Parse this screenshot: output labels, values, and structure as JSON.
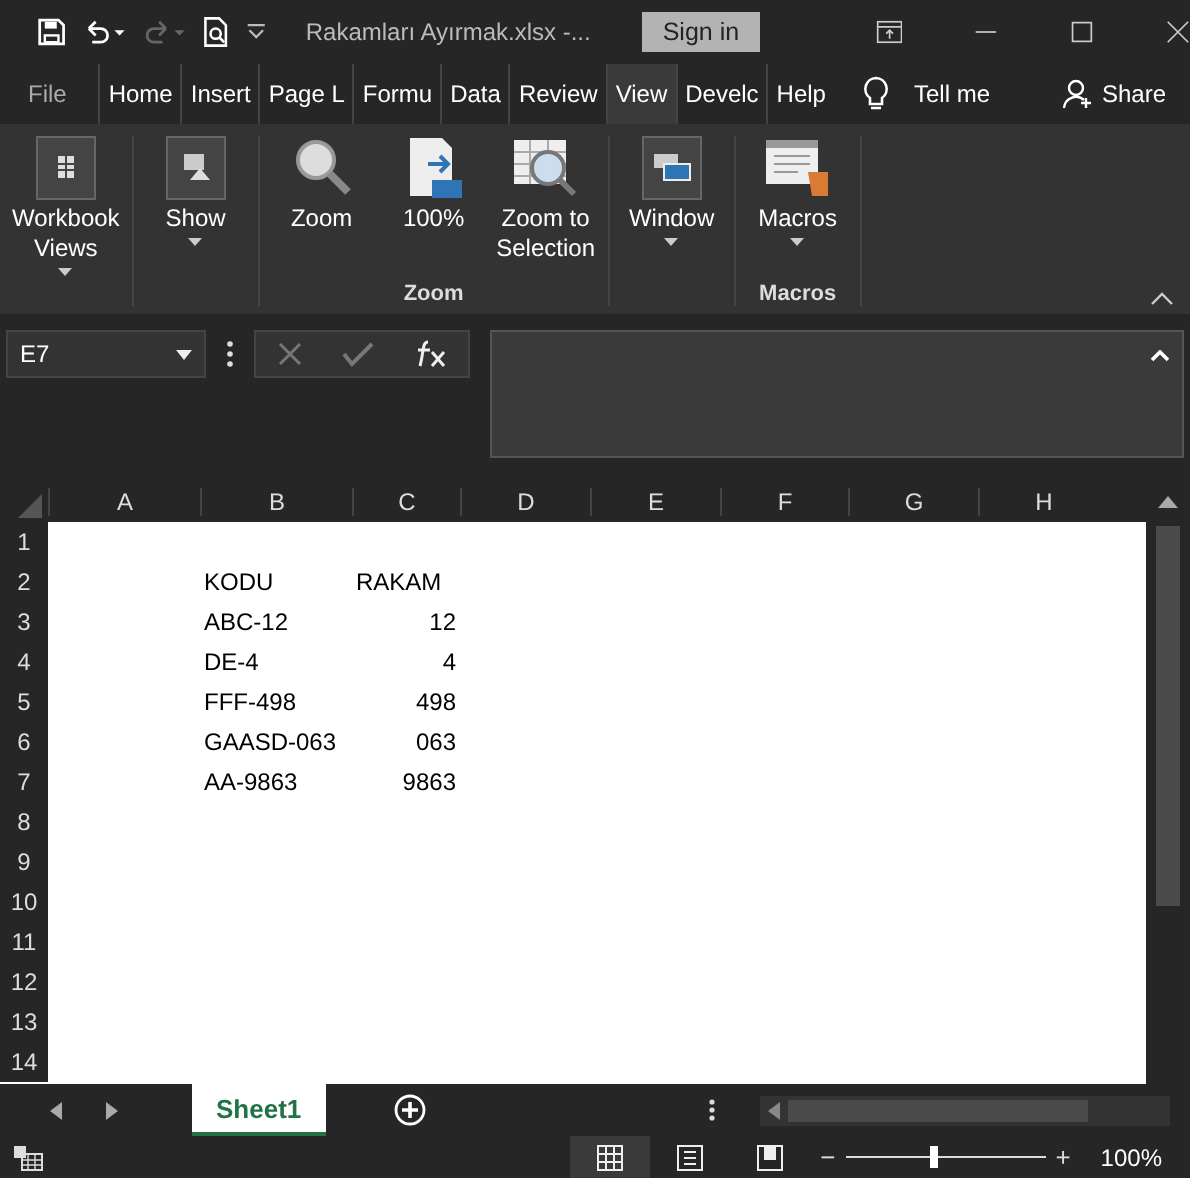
{
  "window": {
    "title": "Rakamları Ayırmak.xlsx  -...",
    "sign_in": "Sign in"
  },
  "menu_tabs": [
    {
      "label": "File",
      "selected": false
    },
    {
      "label": "Home",
      "selected": false
    },
    {
      "label": "Insert",
      "selected": false
    },
    {
      "label": "Page L",
      "selected": false
    },
    {
      "label": "Formu",
      "selected": false
    },
    {
      "label": "Data",
      "selected": false
    },
    {
      "label": "Review",
      "selected": false
    },
    {
      "label": "View",
      "selected": true
    },
    {
      "label": "Develc",
      "selected": false
    },
    {
      "label": "Help",
      "selected": false
    }
  ],
  "tell_me": "Tell me",
  "share": "Share",
  "ribbon": {
    "groups": [
      {
        "buttons": [
          {
            "kind": "workbook",
            "label": "Workbook Views",
            "dropdown": true
          }
        ]
      },
      {
        "buttons": [
          {
            "kind": "show",
            "label": "Show",
            "dropdown": true
          }
        ]
      },
      {
        "title": "Zoom",
        "buttons": [
          {
            "kind": "zoom",
            "label": "Zoom",
            "dropdown": false
          },
          {
            "kind": "hundred",
            "label": "100%",
            "dropdown": false
          },
          {
            "kind": "selection",
            "label": "Zoom to Selection",
            "dropdown": false
          }
        ]
      },
      {
        "buttons": [
          {
            "kind": "window",
            "label": "Window",
            "dropdown": true
          }
        ]
      },
      {
        "title": "Macros",
        "buttons": [
          {
            "kind": "macros",
            "label": "Macros",
            "dropdown": true
          }
        ]
      }
    ]
  },
  "name_box": "E7",
  "columns": [
    "A",
    "B",
    "C",
    "D",
    "E",
    "F",
    "G",
    "H"
  ],
  "rows": [
    {
      "number": "1"
    },
    {
      "number": "2",
      "kind": "header",
      "column_b": "KODU",
      "column_c": "RAKAM"
    },
    {
      "number": "3",
      "kind": "data",
      "column_b": "ABC-12",
      "column_c": "12"
    },
    {
      "number": "4",
      "kind": "data",
      "column_b": "DE-4",
      "column_c": "4"
    },
    {
      "number": "5",
      "kind": "data",
      "column_b": "FFF-498",
      "column_c": "498"
    },
    {
      "number": "6",
      "kind": "data",
      "column_b": "GAASD-063",
      "column_c": "063"
    },
    {
      "number": "7",
      "kind": "data",
      "column_b": "AA-9863",
      "column_c": "9863"
    },
    {
      "number": "8"
    },
    {
      "number": "9"
    },
    {
      "number": "10"
    },
    {
      "number": "11"
    },
    {
      "number": "12"
    },
    {
      "number": "13"
    },
    {
      "number": "14"
    }
  ],
  "sheets": [
    {
      "label": "Sheet1",
      "selected": true
    }
  ],
  "status_bar": {
    "views": [
      {
        "kind": "normal",
        "selected": true
      },
      {
        "kind": "layout",
        "selected": false
      },
      {
        "kind": "break",
        "selected": false
      }
    ],
    "zoom": {
      "level": 0.44,
      "minus": "−",
      "plus": "+",
      "reading": "100%"
    }
  }
}
